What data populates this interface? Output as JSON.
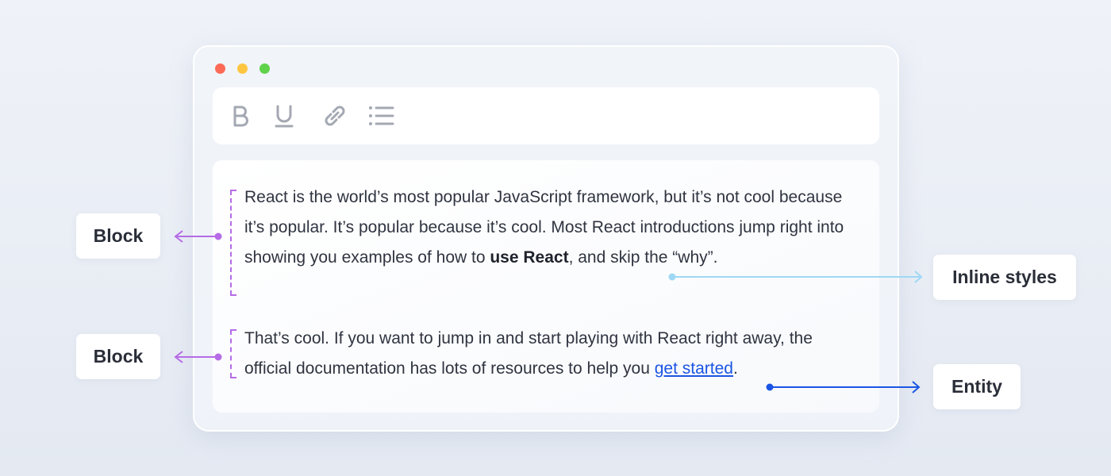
{
  "window": {
    "controls": [
      "close",
      "minimize",
      "maximize"
    ]
  },
  "toolbar": {
    "tools": [
      {
        "name": "bold",
        "icon": "bold-icon"
      },
      {
        "name": "underline",
        "icon": "underline-icon"
      },
      {
        "name": "link",
        "icon": "link-icon"
      },
      {
        "name": "list",
        "icon": "list-icon"
      }
    ]
  },
  "editor": {
    "paragraph1": {
      "text_before": "React is the world’s most popular JavaScript framework, but it’s not cool because it’s popular. It’s popular because it’s cool. Most React introductions jump right into showing you examples of how to ",
      "bold_text": "use React",
      "text_after": ", and skip the “why”."
    },
    "paragraph2": {
      "text_before": "That’s cool. If you want to jump in and start playing with React right away, the official documentation has lots of resources to help you ",
      "link_text": "get started",
      "text_after": "."
    }
  },
  "annotations": {
    "block1": "Block",
    "block2": "Block",
    "inline_styles": "Inline styles",
    "entity": "Entity"
  },
  "colors": {
    "block": "#b56ce6",
    "inline_styles": "#9fd8f5",
    "entity": "#1b55e3"
  }
}
